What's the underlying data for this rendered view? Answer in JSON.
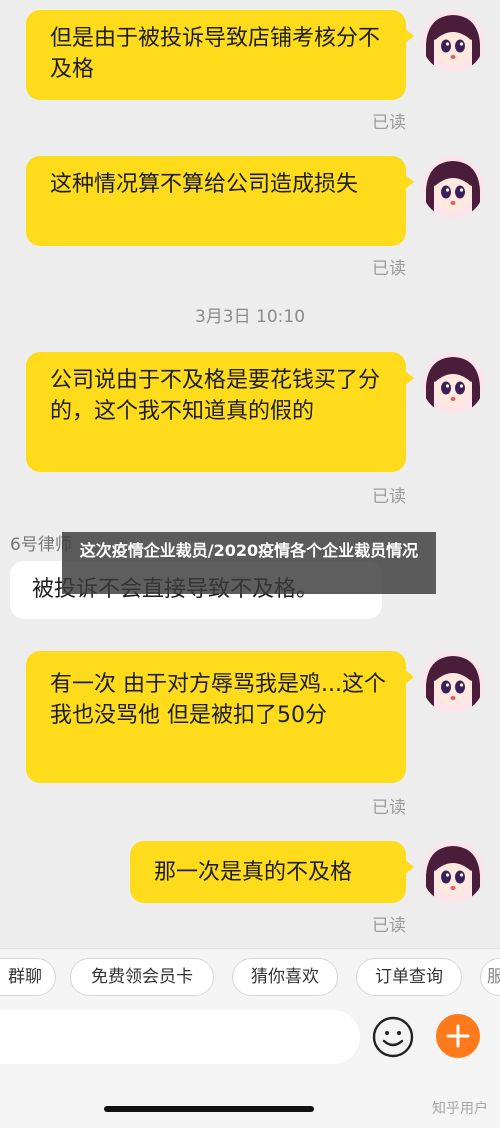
{
  "messages_top": [
    {
      "text": "但是由于被投诉导致店铺考核分不及格",
      "status": "已读"
    },
    {
      "text": "这种情况算不算给公司造成损失",
      "status": "已读"
    }
  ],
  "timestamp": "3月3日 10:10",
  "messages_mid": [
    {
      "text": "公司说由于不及格是要花钱买了分的，这个我不知道真的假的",
      "status": "已读"
    }
  ],
  "incoming": {
    "sender": "6号律师",
    "text": "被投诉不会直接导致不及格。"
  },
  "overlay_title": "这次疫情企业裁员/2020疫情各个企业裁员情况",
  "messages_bottom": [
    {
      "text": "有一次 由于对方辱骂我是鸡...这个我也没骂他 但是被扣了50分",
      "status": "已读"
    },
    {
      "text": "那一次是真的不及格",
      "status": "已读"
    }
  ],
  "quick_replies": [
    "群聊",
    "免费领会员卡",
    "猜你喜欢",
    "订单查询",
    "服"
  ],
  "watermark": "知乎用户",
  "colors": {
    "bubble": "#fedc1c",
    "accent": "#ff7a1a",
    "background": "#ededed"
  },
  "icons": {
    "emoji": "smiley-icon",
    "plus": "plus-icon",
    "avatar": "anime-girl-avatar"
  }
}
